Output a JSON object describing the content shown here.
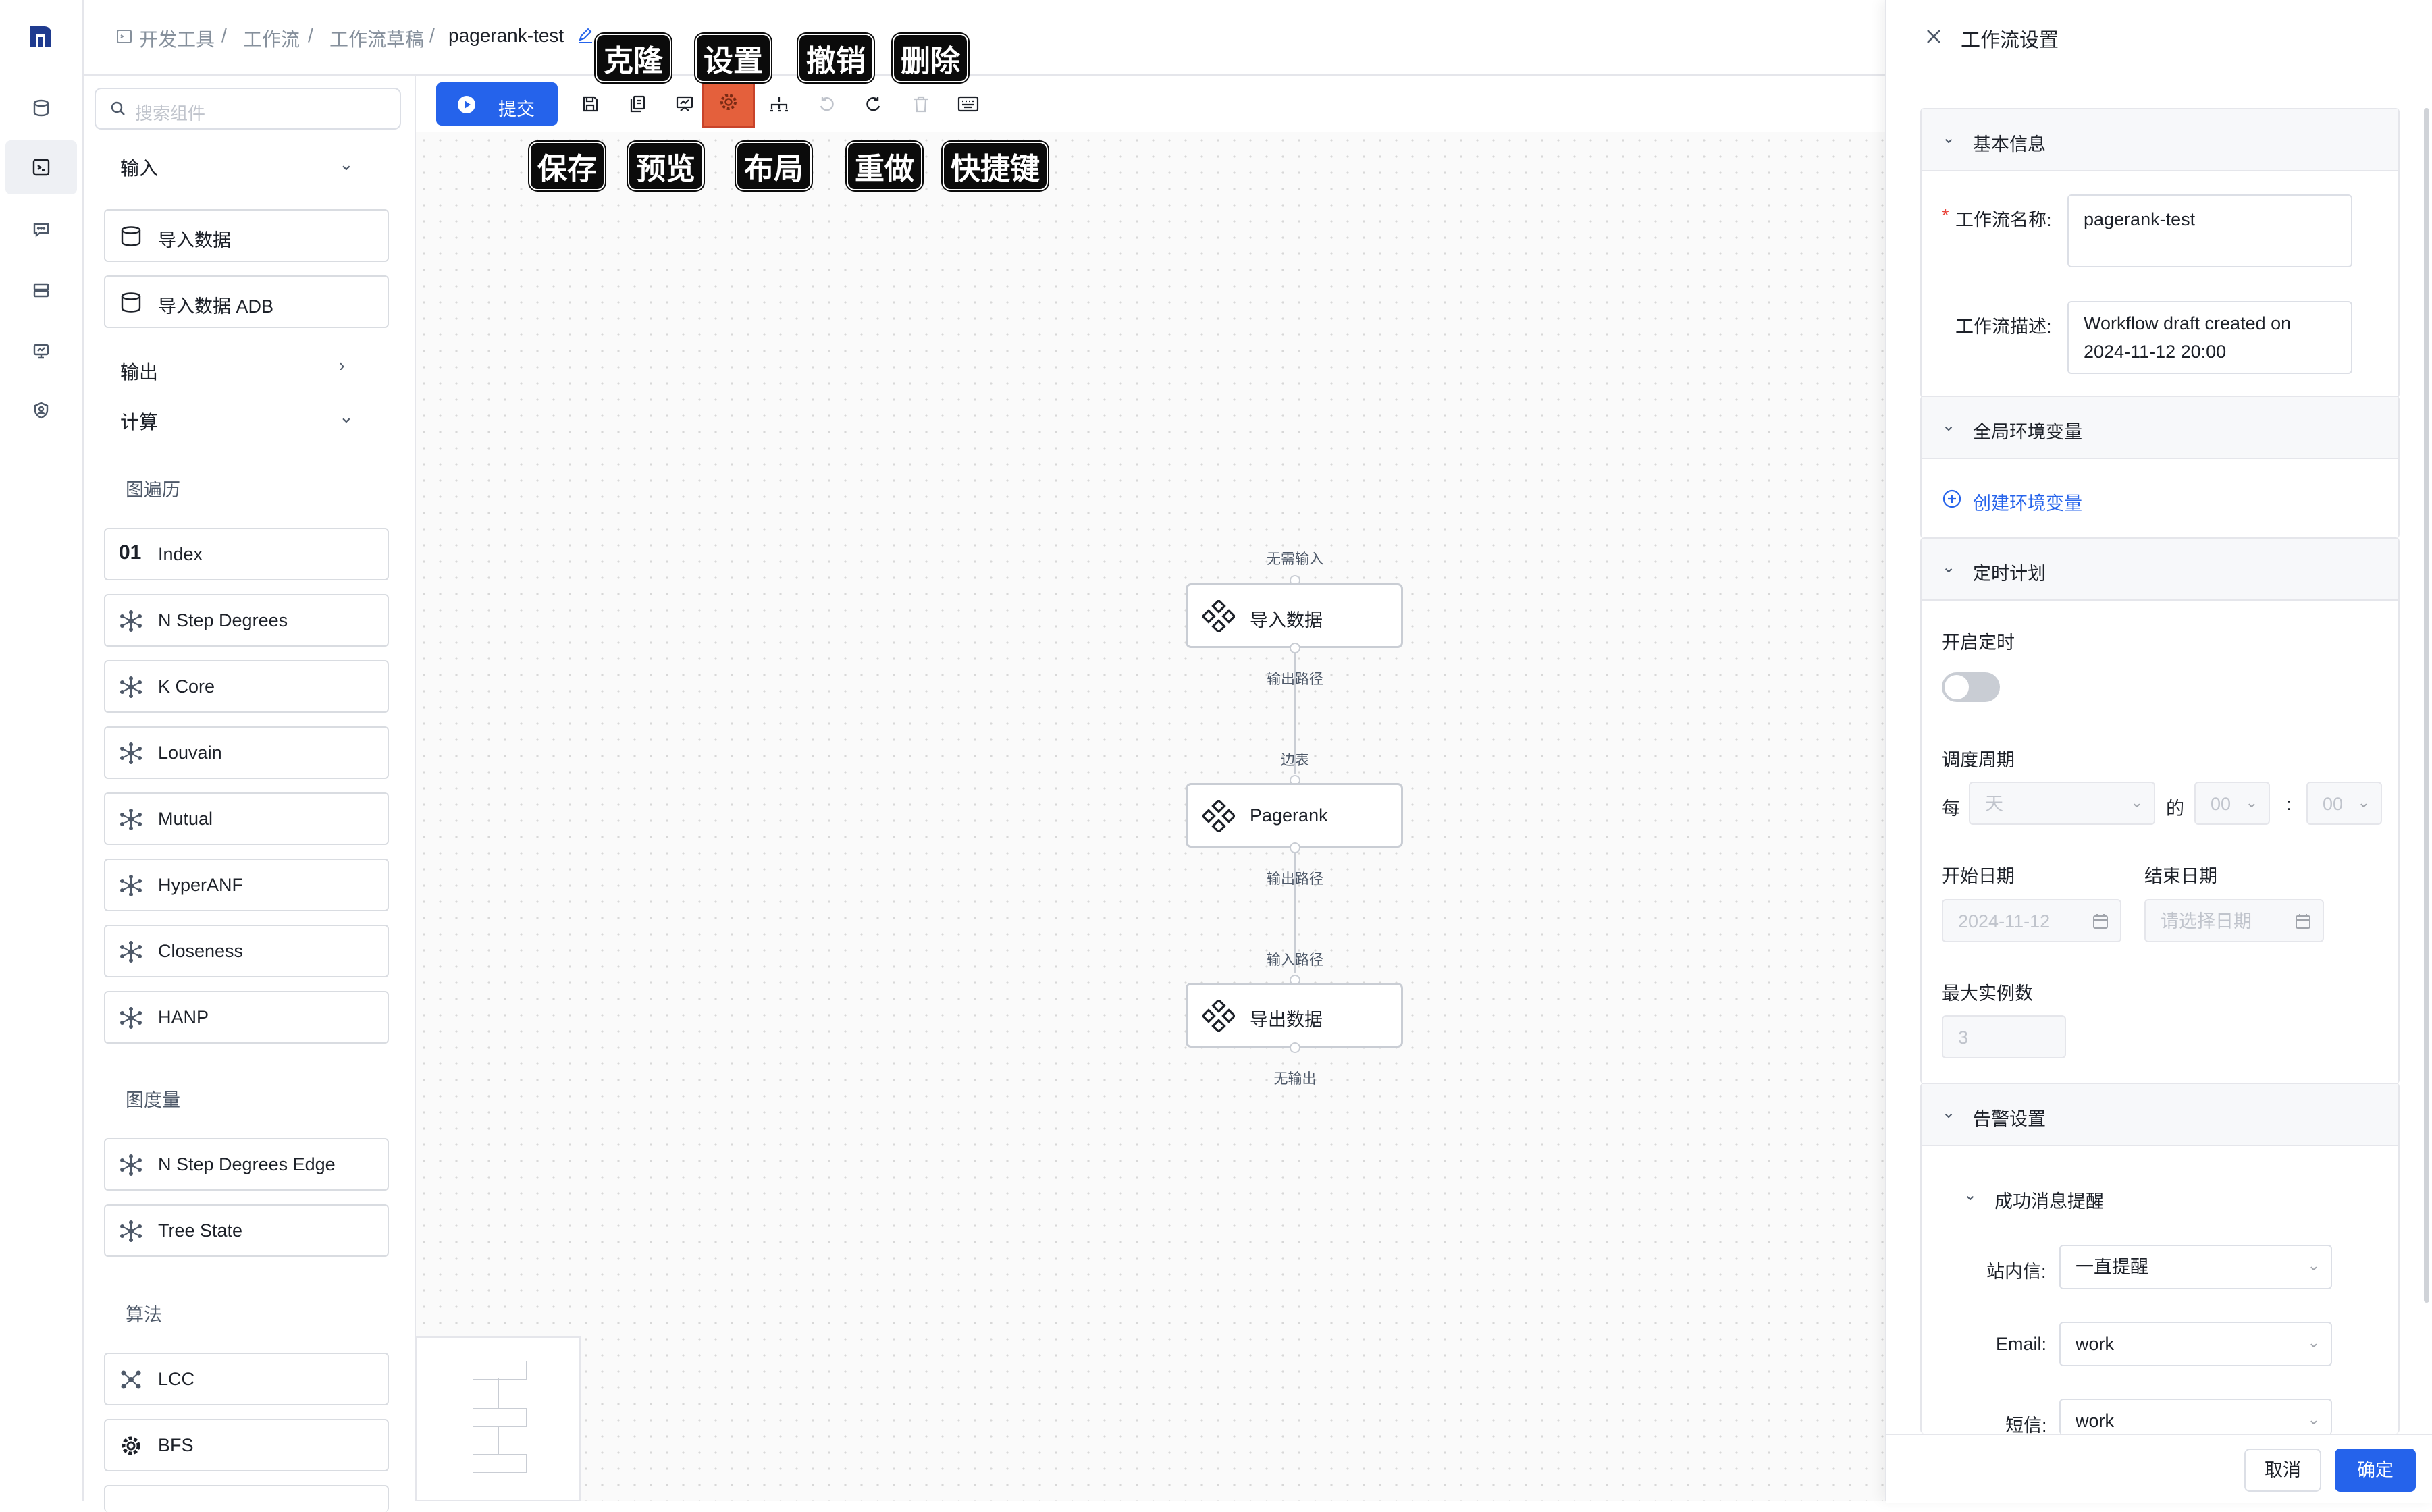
{
  "breadcrumb": [
    "开发工具",
    "工作流",
    "工作流草稿",
    "pagerank-test"
  ],
  "search": {
    "placeholder": "搜索组件"
  },
  "panel": {
    "input_section": "输入",
    "input_items": [
      "导入数据",
      "导入数据 ADB"
    ],
    "output_section": "输出",
    "compute_section": "计算",
    "group_traversal": "图遍历",
    "traversal_items": [
      "Index",
      "N Step Degrees",
      "K Core",
      "Louvain",
      "Mutual",
      "HyperANF",
      "Closeness",
      "HANP"
    ],
    "group_metric": "图度量",
    "metric_items": [
      "N Step Degrees Edge",
      "Tree State"
    ],
    "group_algo": "算法",
    "algo_items": [
      "LCC",
      "BFS"
    ],
    "index_icon_text": "01"
  },
  "toolbar": {
    "submit_label": "提交",
    "annotations_top": [
      "克隆",
      "设置",
      "撤销",
      "删除"
    ],
    "annotations_bottom": [
      "保存",
      "预览",
      "布局",
      "重做",
      "快捷键"
    ]
  },
  "canvas": {
    "nodes": [
      {
        "label": "导入数据",
        "in": "无需输入",
        "out": "输出路径"
      },
      {
        "label": "Pagerank",
        "in": "边表",
        "out": "输出路径"
      },
      {
        "label": "导出数据",
        "in": "输入路径",
        "out": "无输出"
      }
    ]
  },
  "drawer": {
    "title": "工作流设置",
    "basic": {
      "header": "基本信息",
      "required_mark": "*",
      "name_label": "工作流名称:",
      "name_value": "pagerank-test",
      "desc_label": "工作流描述:",
      "desc_value_line1": "Workflow draft created on",
      "desc_value_line2": "2024-11-12 20:00"
    },
    "env": {
      "header": "全局环境变量",
      "create_link": "创建环境变量"
    },
    "schedule": {
      "header": "定时计划",
      "enable_label": "开启定时",
      "enabled": false,
      "period_label": "调度周期",
      "every": "每",
      "unit": "天",
      "of": "的",
      "hour": "00",
      "colon": ":",
      "minute": "00",
      "start_label": "开始日期",
      "start_value": "2024-11-12",
      "end_label": "结束日期",
      "end_placeholder": "请选择日期",
      "max_label": "最大实例数",
      "max_value": "3"
    },
    "alert": {
      "header": "告警设置",
      "sub_header": "成功消息提醒",
      "site_label": "站内信:",
      "site_value": "一直提醒",
      "email_label": "Email:",
      "email_value": "work",
      "sms_label": "短信:",
      "sms_value": "work"
    },
    "cancel": "取消",
    "confirm": "确定"
  },
  "colors": {
    "primary": "#2563eb",
    "highlight": "#e4603c"
  }
}
